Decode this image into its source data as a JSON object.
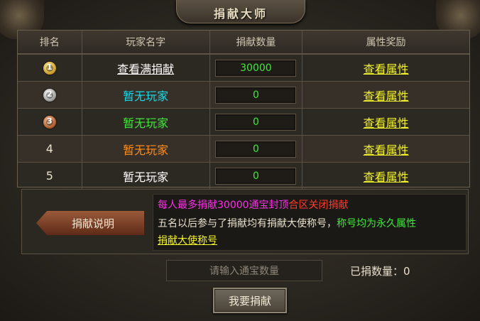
{
  "title": "捐献大师",
  "columns": [
    "排名",
    "玩家名字",
    "捐献数量",
    "属性奖励"
  ],
  "rows": [
    {
      "rank": "1",
      "name": "查看满捐献",
      "amount": "30000",
      "reward": "查看属性"
    },
    {
      "rank": "2",
      "name": "暂无玩家",
      "amount": "0",
      "reward": "查看属性"
    },
    {
      "rank": "3",
      "name": "暂无玩家",
      "amount": "0",
      "reward": "查看属性"
    },
    {
      "rank": "4",
      "name": "暂无玩家",
      "amount": "0",
      "reward": "查看属性"
    },
    {
      "rank": "5",
      "name": "暂无玩家",
      "amount": "0",
      "reward": "查看属性"
    }
  ],
  "info": {
    "tag": "捐献说明",
    "line1_a": "每人最多捐献30000通宝封顶",
    "line1_b": "合区关闭捐献",
    "line2_a": "五名以后参与了捐献均有捐献大使称号，",
    "line2_b": "称号均为永久属性",
    "line3": "捐献大使称号"
  },
  "input": {
    "placeholder": "请输入通宝数量"
  },
  "donated_label": "已捐数量：",
  "donated_value": "0",
  "button": "我要捐献",
  "colors": {
    "green": "#41e63a",
    "yellow": "#f2f22a",
    "magenta": "#ff2ee6",
    "red": "#ff3a2e",
    "cyan": "#19d8e8",
    "orange": "#ff8c1a"
  }
}
